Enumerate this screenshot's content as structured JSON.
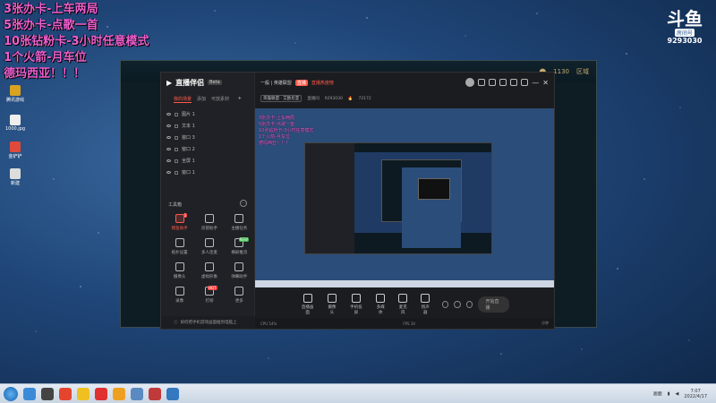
{
  "overlay": {
    "lines": [
      "3张办卡-上车两局",
      "5张办卡-点歌一首",
      "10张钻粉卡-3小时任意模式",
      "1个火箭-月车位",
      "德玛西亚！！！"
    ]
  },
  "douyu": {
    "mark": "斗鱼",
    "tag": "房间号",
    "room_id": "9293030"
  },
  "desktop_icons": [
    "腾讯游戏",
    "1000.jpg",
    "金铲铲",
    "新建"
  ],
  "game": {
    "coins": "1130",
    "region": "区域"
  },
  "app": {
    "name": "直播伴侣",
    "beta": "Beta",
    "tabs": [
      "我的场景",
      "添加",
      "可放素材"
    ],
    "add": "+",
    "scenes": [
      "图片 1",
      "文本 1",
      "窗口 3",
      "窗口 2",
      "全屏 1",
      "窗口 1"
    ],
    "tools_title": "工具箱",
    "tools_more": "···",
    "tools": [
      {
        "label": "摸鱼助手",
        "dot": "1"
      },
      {
        "label": "房管助手"
      },
      {
        "label": "主播任务"
      },
      {
        "label": "拓扑设置"
      },
      {
        "label": "多人连麦"
      },
      {
        "label": "横屏推流",
        "tag": "NEW"
      },
      {
        "label": "摄像头"
      },
      {
        "label": "虚拟形象"
      },
      {
        "label": "弹幕助手"
      },
      {
        "label": "录像"
      },
      {
        "label": "打榜",
        "tag": "HOT"
      },
      {
        "label": "更多"
      }
    ],
    "footer": "如何把手机游戏画面推到电脑上",
    "main": {
      "category": "一般 | 英雄联盟",
      "live_badge": "直播",
      "hot_label": "直播热度榜",
      "room_title": "英雄联盟 · 艾欧尼亚",
      "room_link": "直播间",
      "room_id": "9293030",
      "popularity": "72172"
    },
    "bottom": [
      "直播画面",
      "摄像头",
      "手机投屏",
      "多媒体",
      "麦克风",
      "扬声器"
    ],
    "start_label": "开始直播",
    "status_left": "CPU 54%",
    "status_mid": "FPS 30",
    "status_right": "分钟"
  },
  "taskbar": {
    "time": "7:07",
    "date": "2022/4/17",
    "tray_label": "画面"
  }
}
